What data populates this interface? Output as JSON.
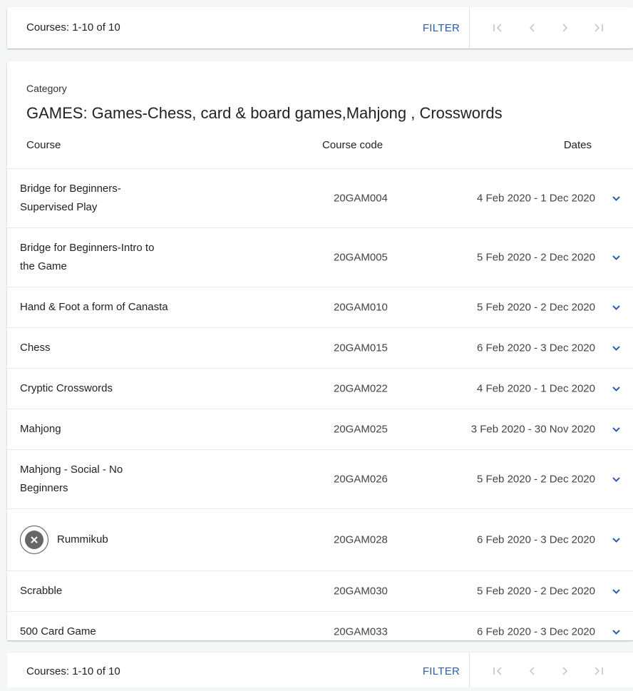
{
  "pager": {
    "count_text": "Courses: 1-10 of 10",
    "filter_label": "FILTER",
    "nav": {
      "first": "first-page",
      "prev": "previous-page",
      "next": "next-page",
      "last": "last-page"
    }
  },
  "category": {
    "label": "Category",
    "title": "GAMES: Games-Chess, card & board games,Mahjong , Crosswords"
  },
  "table": {
    "headers": {
      "course": "Course",
      "code": "Course code",
      "dates": "Dates"
    },
    "rows": [
      {
        "name": "Bridge for Beginners-\nSupervised Play",
        "code": "20GAM004",
        "dates": "4 Feb 2020 - 1 Dec 2020",
        "cancelled": false
      },
      {
        "name": "Bridge for Beginners-Intro to\nthe Game",
        "code": "20GAM005",
        "dates": "5 Feb 2020 - 2 Dec 2020",
        "cancelled": false
      },
      {
        "name": "Hand & Foot a form of Canasta",
        "code": "20GAM010",
        "dates": "5 Feb 2020 - 2 Dec 2020",
        "cancelled": false
      },
      {
        "name": "Chess",
        "code": "20GAM015",
        "dates": "6 Feb 2020 - 3 Dec 2020",
        "cancelled": false
      },
      {
        "name": "Cryptic Crosswords",
        "code": "20GAM022",
        "dates": "4 Feb 2020 - 1 Dec 2020",
        "cancelled": false
      },
      {
        "name": "Mahjong",
        "code": "20GAM025",
        "dates": "3 Feb 2020 - 30 Nov 2020",
        "cancelled": false
      },
      {
        "name": "Mahjong - Social - No\nBeginners",
        "code": "20GAM026",
        "dates": "5 Feb 2020 - 2 Dec 2020",
        "cancelled": false
      },
      {
        "name": "Rummikub",
        "code": "20GAM028",
        "dates": "6 Feb 2020 - 3 Dec 2020",
        "cancelled": true
      },
      {
        "name": "Scrabble",
        "code": "20GAM030",
        "dates": "5 Feb 2020 - 2 Dec 2020",
        "cancelled": false
      },
      {
        "name": "500 Card Game",
        "code": "20GAM033",
        "dates": "6 Feb 2020 - 3 Dec 2020",
        "cancelled": false
      }
    ]
  },
  "colors": {
    "accent": "#2c5fa8",
    "muted_nav": "#b9bdc3",
    "cancel_badge": "#666666"
  }
}
